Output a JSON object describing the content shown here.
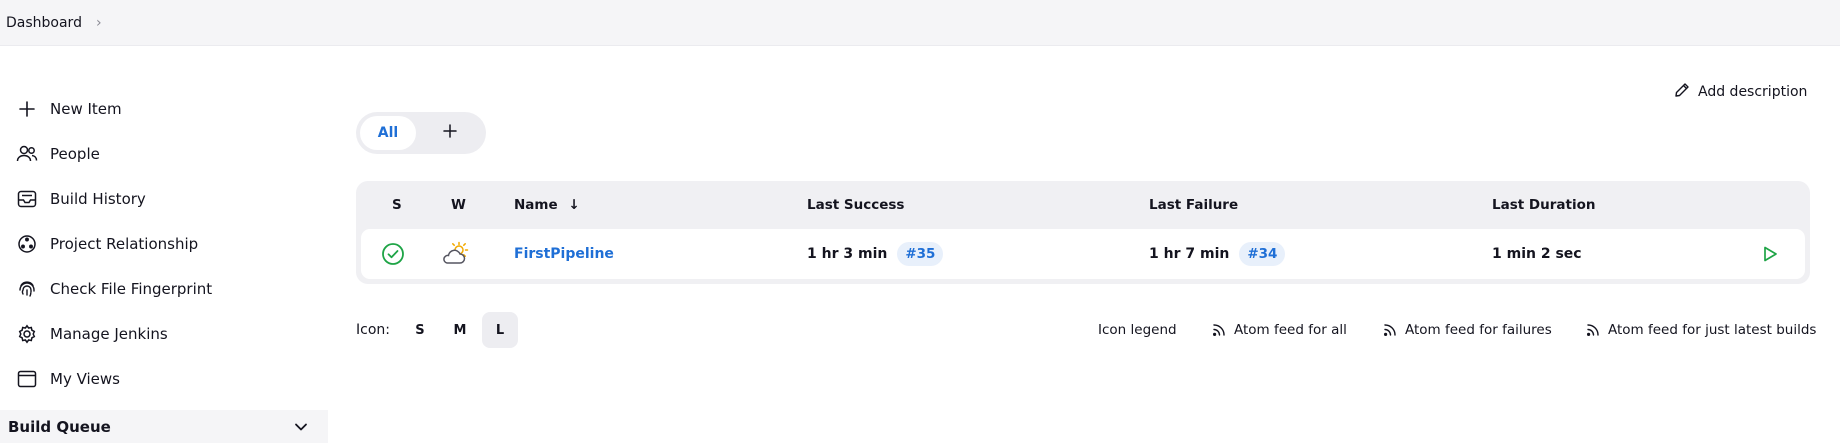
{
  "breadcrumb": {
    "root": "Dashboard",
    "separator": "›"
  },
  "sidebar": {
    "items": [
      {
        "label": "New Item",
        "icon": "plus-icon"
      },
      {
        "label": "People",
        "icon": "people-icon"
      },
      {
        "label": "Build History",
        "icon": "inbox-icon"
      },
      {
        "label": "Project Relationship",
        "icon": "relationship-icon"
      },
      {
        "label": "Check File Fingerprint",
        "icon": "fingerprint-icon"
      },
      {
        "label": "Manage Jenkins",
        "icon": "gear-icon"
      },
      {
        "label": "My Views",
        "icon": "window-icon"
      }
    ],
    "build_queue": {
      "label": "Build Queue",
      "icon": "chevron-down-icon"
    }
  },
  "main": {
    "add_description": "Add description",
    "tabs": [
      {
        "label": "All",
        "active": true
      }
    ],
    "table": {
      "headers": {
        "s": "S",
        "w": "W",
        "name": "Name",
        "name_sort": "↓",
        "last_success": "Last Success",
        "last_failure": "Last Failure",
        "last_duration": "Last Duration"
      },
      "rows": [
        {
          "status": "success",
          "weather": "partly-cloudy",
          "name": "FirstPipeline",
          "last_success_time": "1 hr 3 min",
          "last_success_build": "#35",
          "last_failure_time": "1 hr 7 min",
          "last_failure_build": "#34",
          "last_duration": "1 min 2 sec"
        }
      ]
    },
    "icon_size": {
      "label": "Icon:",
      "options": [
        "S",
        "M",
        "L"
      ],
      "selected": "L"
    },
    "footer_links": {
      "legend": "Icon legend",
      "atom_all": "Atom feed for all",
      "atom_failures": "Atom feed for failures",
      "atom_latest": "Atom feed for just latest builds"
    }
  },
  "colors": {
    "accent": "#1f6fd6",
    "success": "#1ea446",
    "surface": "#f5f5f7"
  }
}
